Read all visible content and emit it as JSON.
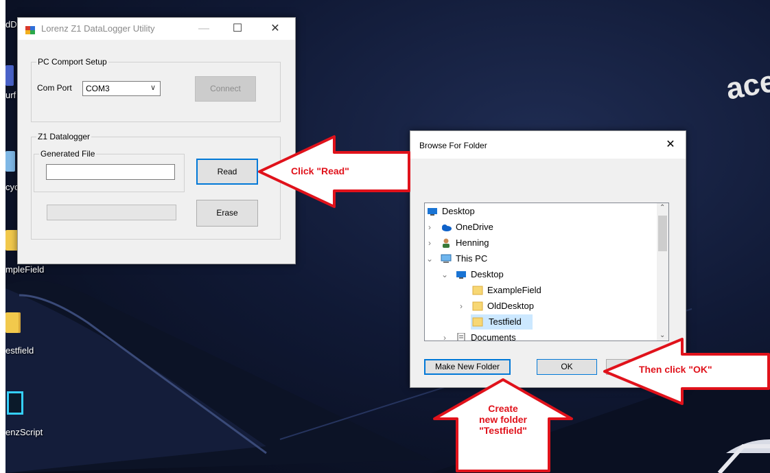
{
  "desktop": {
    "icons": [
      {
        "label": "dDe"
      },
      {
        "label": "urf"
      },
      {
        "label": "cyc"
      },
      {
        "label": "mpleField"
      },
      {
        "label": "estfield"
      },
      {
        "label": "enzScript"
      }
    ],
    "brand_text": "acer"
  },
  "z1_window": {
    "title": "Lorenz Z1 DataLogger Utility",
    "comport_group": {
      "label": "PC Comport Setup",
      "com_port_label": "Com Port",
      "com_port_value": "COM3",
      "connect_label": "Connect"
    },
    "datalogger_group": {
      "label": "Z1 Datalogger",
      "generated_file_label": "Generated File",
      "generated_file_value": "",
      "read_label": "Read",
      "erase_label": "Erase"
    }
  },
  "browse_dialog": {
    "title": "Browse For Folder",
    "tree": [
      {
        "label": "Desktop",
        "icon": "desktop-icon"
      },
      {
        "label": "OneDrive",
        "icon": "cloud-icon"
      },
      {
        "label": "Henning",
        "icon": "user-icon"
      },
      {
        "label": "This PC",
        "icon": "computer-icon"
      },
      {
        "label": "Desktop",
        "icon": "desktop-icon"
      },
      {
        "label": "ExampleField",
        "icon": "folder-icon"
      },
      {
        "label": "OldDesktop",
        "icon": "folder-icon"
      },
      {
        "label": "Testfield",
        "icon": "folder-icon",
        "selected": true
      },
      {
        "label": "Documents",
        "icon": "documents-icon"
      }
    ],
    "make_new_folder_label": "Make New Folder",
    "ok_label": "OK",
    "cancel_label": ""
  },
  "annotations": {
    "read": "Click \"Read\"",
    "ok": "Then click \"OK\"",
    "create_line1": "Create",
    "create_line2": "new folder",
    "create_line3": "\"Testfield\""
  },
  "colors": {
    "annotation_red": "#e0121b",
    "selection": "#cce8ff",
    "focus_blue": "#0078d7"
  }
}
